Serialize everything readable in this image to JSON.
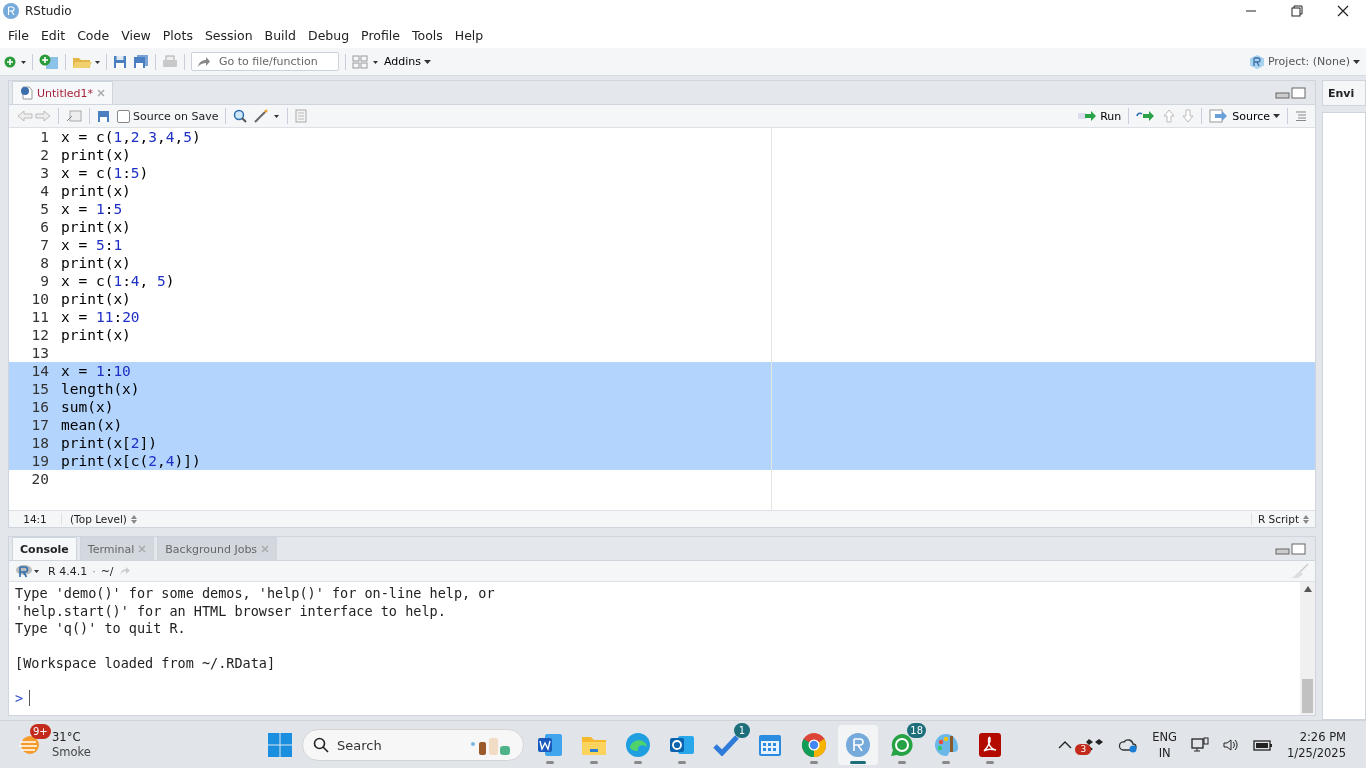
{
  "window": {
    "title": "RStudio"
  },
  "menu": [
    "File",
    "Edit",
    "Code",
    "View",
    "Plots",
    "Session",
    "Build",
    "Debug",
    "Profile",
    "Tools",
    "Help"
  ],
  "toolbar": {
    "goto_placeholder": "Go to file/function",
    "addins": "Addins",
    "project": "Project: (None)"
  },
  "editor": {
    "tabs": [
      {
        "label": "Untitled1*",
        "selected": true,
        "modified": true
      }
    ],
    "source_on_save": {
      "label": "Source on Save",
      "checked": false
    },
    "run": "Run",
    "source": "Source",
    "lines": [
      {
        "num": "1",
        "text": "x = c(1,2,3,4,5)",
        "selected": false
      },
      {
        "num": "2",
        "text": "print(x)",
        "selected": false
      },
      {
        "num": "3",
        "text": "x = c(1:5)",
        "selected": false
      },
      {
        "num": "4",
        "text": "print(x)",
        "selected": false
      },
      {
        "num": "5",
        "text": "x = 1:5",
        "selected": false
      },
      {
        "num": "6",
        "text": "print(x)",
        "selected": false
      },
      {
        "num": "7",
        "text": "x = 5:1",
        "selected": false
      },
      {
        "num": "8",
        "text": "print(x)",
        "selected": false
      },
      {
        "num": "9",
        "text": "x = c(1:4, 5)",
        "selected": false
      },
      {
        "num": "10",
        "text": "print(x)",
        "selected": false
      },
      {
        "num": "11",
        "text": "x = 11:20",
        "selected": false
      },
      {
        "num": "12",
        "text": "print(x)",
        "selected": false
      },
      {
        "num": "13",
        "selected": false
      },
      {
        "num": "14",
        "text": "x = 1:10",
        "selected": true
      },
      {
        "num": "15",
        "text": "length(x)",
        "selected": true
      },
      {
        "num": "16",
        "text": "sum(x)",
        "selected": true
      },
      {
        "num": "17",
        "text": "mean(x)",
        "selected": true
      },
      {
        "num": "18",
        "text": "print(x[2])",
        "selected": true
      },
      {
        "num": "19",
        "text": "print(x[c(2,4)])",
        "selected": true
      },
      {
        "num": "20",
        "selected": false
      }
    ],
    "status": {
      "position": "14:1",
      "scope": "(Top Level)",
      "filetype": "R Script"
    }
  },
  "console": {
    "tabs": [
      {
        "label": "Console",
        "selected": true,
        "closable": false
      },
      {
        "label": "Terminal",
        "selected": false,
        "closable": true
      },
      {
        "label": "Background Jobs",
        "selected": false,
        "closable": true
      }
    ],
    "version": "R 4.4.1",
    "separator": "·",
    "path": "~/",
    "paragraphs": [
      [
        "Type 'demo()' for some demos, 'help()' for on-line help, or",
        "'help.start()' for an HTML browser interface to help.",
        "Type 'q()' to quit R."
      ],
      [
        "[Workspace loaded from ~/.RData]"
      ]
    ],
    "prompt": ">"
  },
  "right_pane": {
    "tab": "Envi"
  },
  "taskbar": {
    "weather": {
      "temp": "31°C",
      "condition": "Smoke",
      "badge": "9+"
    },
    "search_placeholder": "Search",
    "apps": [
      {
        "kind": "doc",
        "running": true,
        "active": false
      },
      {
        "kind": "folder",
        "running": true,
        "active": false
      },
      {
        "kind": "swirl",
        "running": true,
        "active": false
      },
      {
        "kind": "mail",
        "running": true,
        "active": false
      },
      {
        "kind": "check",
        "running": false,
        "active": false,
        "badge": "1"
      },
      {
        "kind": "calendar",
        "running": false,
        "active": false
      },
      {
        "kind": "ring",
        "running": true,
        "active": false
      },
      {
        "kind": "r",
        "running": true,
        "active": true
      },
      {
        "kind": "chat",
        "running": true,
        "active": false,
        "badge": "18"
      },
      {
        "kind": "palette",
        "running": true,
        "active": false
      },
      {
        "kind": "pdf",
        "running": true,
        "active": false
      }
    ],
    "tray_badge": "3",
    "language": "ENG",
    "region": "IN",
    "time": "2:26 PM",
    "date": "1/25/2025"
  }
}
